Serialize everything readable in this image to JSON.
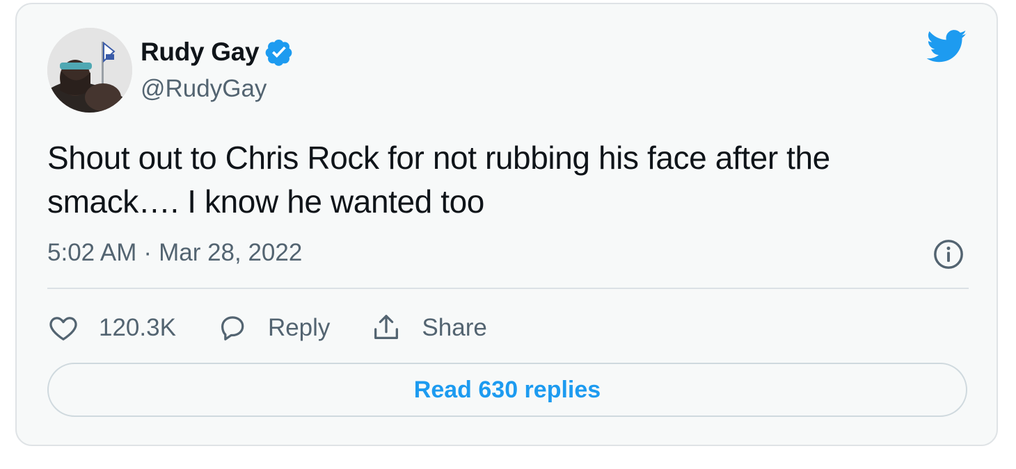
{
  "tweet": {
    "author_name": "Rudy Gay",
    "handle": "@RudyGay",
    "verified": true,
    "text": "Shout out to Chris Rock for not rubbing his face after the smack…. I know he wanted too",
    "time": "5:02 AM",
    "separator": "·",
    "date": "Mar 28, 2022"
  },
  "actions": {
    "like_count": "120.3K",
    "reply_label": "Reply",
    "share_label": "Share"
  },
  "read_replies_label": "Read 630 replies",
  "colors": {
    "accent": "#1d9bf0",
    "text_primary": "#0f1419",
    "text_secondary": "#536471",
    "card_bg": "#f7f9f9"
  },
  "icons": [
    "avatar-photo",
    "verified-badge-icon",
    "twitter-bird-icon",
    "info-icon",
    "heart-icon",
    "speech-bubble-icon",
    "share-upload-icon"
  ]
}
